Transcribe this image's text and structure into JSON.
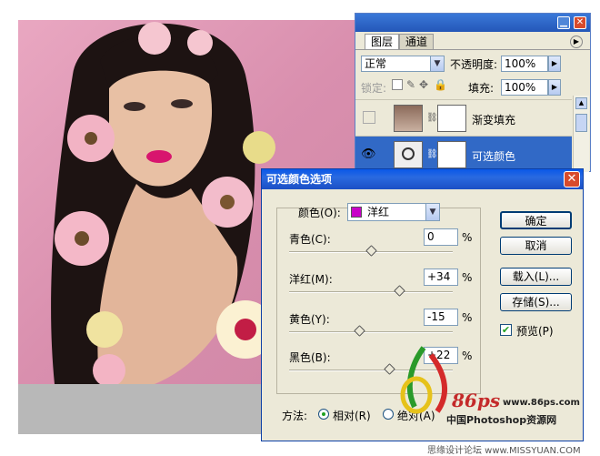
{
  "layers_panel": {
    "tabs": [
      "图层",
      "通道"
    ],
    "blend_mode": "正常",
    "opacity_label": "不透明度:",
    "opacity_value": "100%",
    "lock_label": "锁定:",
    "fill_label": "填充:",
    "fill_value": "100%",
    "layers": [
      {
        "name": "渐变填充"
      },
      {
        "name": "可选颜色"
      }
    ]
  },
  "dialog": {
    "title": "可选颜色选项",
    "color_label": "颜色(O):",
    "color_value": "洋红",
    "color_swatch": "#c800c8",
    "sliders": [
      {
        "label": "青色(C):",
        "value": "0",
        "unit": "%",
        "fraction": 0.5
      },
      {
        "label": "洋红(M):",
        "value": "+34",
        "unit": "%",
        "fraction": 0.67
      },
      {
        "label": "黄色(Y):",
        "value": "-15",
        "unit": "%",
        "fraction": 0.43
      },
      {
        "label": "黑色(B):",
        "value": "+22",
        "unit": "%",
        "fraction": 0.61
      }
    ],
    "method_label": "方法:",
    "method_options": [
      "相对(R)",
      "绝对(A)"
    ],
    "method_selected": "相对(R)",
    "buttons": {
      "ok": "确定",
      "cancel": "取消",
      "load": "载入(L)...",
      "save": "存储(S)..."
    },
    "preview_label": "预览(P)",
    "preview_checked": true
  },
  "watermark": {
    "logo_text": "86ps",
    "site": "www.86ps.com",
    "caption": "中国Photoshop资源网",
    "footer": "思缘设计论坛  www.MISSYUAN.COM"
  }
}
